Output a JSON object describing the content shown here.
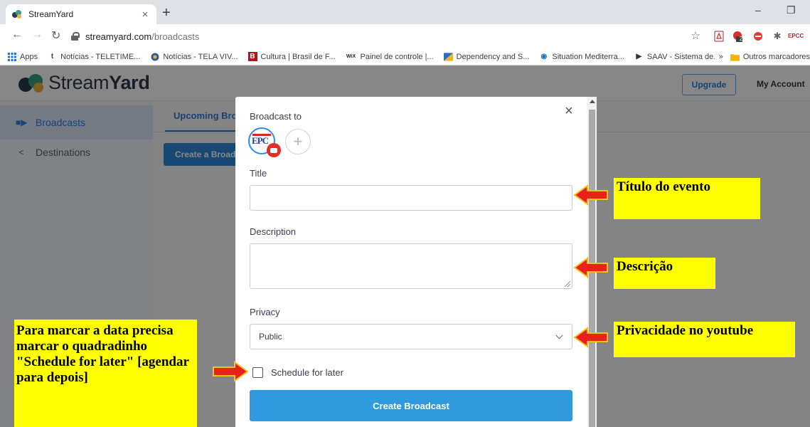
{
  "browser": {
    "tab_title": "StreamYard",
    "tab_close": "×",
    "new_tab": "+",
    "url_host": "streamyard.com",
    "url_path": "/broadcasts",
    "window_controls": {
      "minimize": "–",
      "restore": "❐"
    },
    "extension_badge": "2",
    "extension_epcc_label": "EPCC"
  },
  "bookmarks": {
    "items": [
      {
        "label": "Apps",
        "icon": "apps-grid-icon",
        "color": "#1a73e8"
      },
      {
        "label": "Notícias - TELETIME...",
        "icon": "teletime-icon",
        "color": "#1a3f8c"
      },
      {
        "label": "Notícias - TELA VIV...",
        "icon": "tela-viva-icon",
        "color": "#c0392b"
      },
      {
        "label": "Cultura | Brasil de F...",
        "icon": "brasil-de-fato-icon",
        "color": "#b3121d"
      },
      {
        "label": "Painel de controle |...",
        "icon": "wix-icon",
        "color": "#222222"
      },
      {
        "label": "Dependency and S...",
        "icon": "dependency-icon",
        "color": "#2a6ebb"
      },
      {
        "label": "Situation Mediterra...",
        "icon": "unhcr-icon",
        "color": "#1e74bb"
      },
      {
        "label": "SAAV - Sistema de...",
        "icon": "play-icon",
        "color": "#333333"
      }
    ],
    "overflow": "»",
    "other_folder": "Outros marcadores"
  },
  "streamyard": {
    "logo_light": "Stream",
    "logo_bold": "Yard",
    "upgrade": "Upgrade",
    "my_account": "My Account",
    "sidebar": [
      {
        "label": "Broadcasts",
        "icon": "camera-icon",
        "active": true
      },
      {
        "label": "Destinations",
        "icon": "share-icon",
        "active": false
      }
    ],
    "tab_upcoming": "Upcoming Broadcasts",
    "create_button": "Create a Broadcast"
  },
  "modal": {
    "broadcast_to_label": "Broadcast to",
    "destination_avatar_text": "EPC",
    "close": "×",
    "add_destination": "+",
    "title_label": "Title",
    "title_value": "",
    "description_label": "Description",
    "description_value": "",
    "privacy_label": "Privacy",
    "privacy_value": "Public",
    "schedule_label": "Schedule for later",
    "schedule_checked": false,
    "submit_label": "Create Broadcast"
  },
  "annotations": {
    "title_note": "Título do evento",
    "description_note": "Descrição",
    "privacy_note": "Privacidade no youtube",
    "schedule_note": "Para marcar a data precisa marcar o quadradinho \"Schedule for later\" [agendar para depois]",
    "highlight_color": "#ffff00",
    "arrow_color": "#e8211b"
  }
}
